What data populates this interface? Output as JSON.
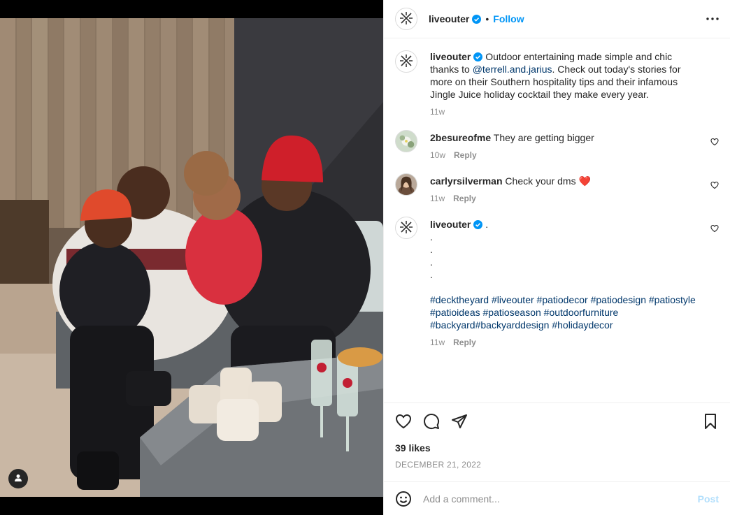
{
  "post": {
    "username": "liveouter",
    "follow_label": "Follow",
    "separator": "•",
    "more_icon": "more-horizontal-icon"
  },
  "caption": {
    "username": "liveouter",
    "text_before": "Outdoor entertaining made simple and chic thanks to ",
    "mention": "@terrell.and.jarius",
    "text_after": ". Check out today's stories for more on their Southern hospitality tips and their infamous Jingle Juice holiday cocktail they make every year.",
    "time": "11w"
  },
  "comments": [
    {
      "username": "2besureofme",
      "text": "They are getting bigger",
      "time": "10w",
      "reply_label": "Reply"
    },
    {
      "username": "carlyrsilverman",
      "text": "Check your dms ",
      "emoji": "❤️",
      "time": "11w",
      "reply_label": "Reply"
    }
  ],
  "hashtag_comment": {
    "username": "liveouter",
    "text": ".",
    "dots": [
      ".",
      ".",
      ".",
      "."
    ],
    "hashtags": "#decktheyard #liveouter #patiodecor #patiodesign #patiostyle #patioideas #patioseason #outdoorfurniture #backyard#backyarddesign #holidaydecor",
    "time": "11w",
    "reply_label": "Reply"
  },
  "stats": {
    "likes": "39 likes",
    "date": "DECEMBER 21, 2022"
  },
  "composer": {
    "placeholder": "Add a comment...",
    "post_label": "Post"
  },
  "colors": {
    "accent": "#0095f6",
    "link": "#00376b",
    "muted": "#8e8e8e",
    "post_disabled": "#b2dffc"
  }
}
